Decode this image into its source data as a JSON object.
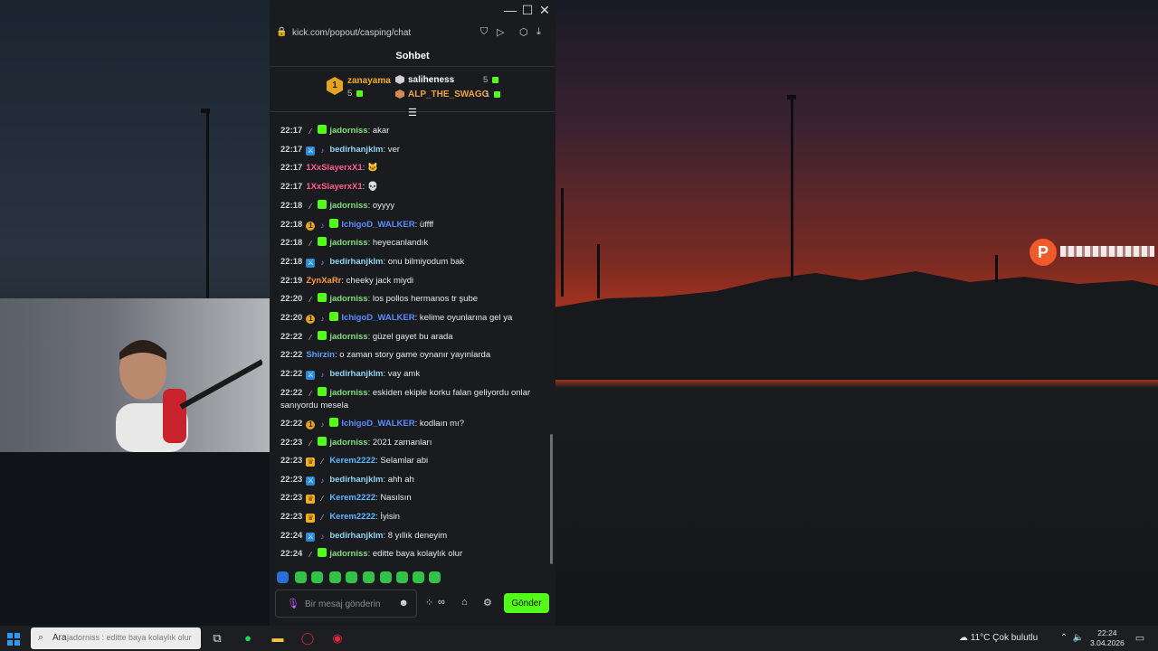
{
  "browser": {
    "url": "kick.com/popout/casping/chat",
    "window_controls": [
      "—",
      "☐",
      "✕"
    ]
  },
  "chat": {
    "title": "Sohbet",
    "leaderboard": {
      "first": {
        "rank": "1",
        "name": "zanayama",
        "count": "5"
      },
      "second": {
        "name": "saliheness",
        "count": "5"
      },
      "third": {
        "name": "ALP_THE_SWAGG",
        "count": "1"
      }
    },
    "messages": [
      {
        "time": "22:17",
        "badges": [
          "sword",
          "green"
        ],
        "user": "jadorniss",
        "color": "#7fe07a",
        "text": "akar"
      },
      {
        "time": "22:17",
        "badges": [
          "blue",
          "note"
        ],
        "user": "bedirhanjklm",
        "color": "#8fd4f0",
        "text": "ver"
      },
      {
        "time": "22:17",
        "badges": [],
        "user": "1XxSlayerxX1",
        "color": "#ff5c8a",
        "text": "🐱"
      },
      {
        "time": "22:17",
        "badges": [],
        "user": "1XxSlayerxX1",
        "color": "#ff5c8a",
        "text": "💀"
      },
      {
        "time": "22:18",
        "badges": [
          "sword",
          "green"
        ],
        "user": "jadorniss",
        "color": "#7fe07a",
        "text": "oyyyy"
      },
      {
        "time": "22:18",
        "badges": [
          "gold",
          "note",
          "green"
        ],
        "user": "IchigoD_WALKER",
        "color": "#5a8cff",
        "text": "üffff"
      },
      {
        "time": "22:18",
        "badges": [
          "sword",
          "green"
        ],
        "user": "jadorniss",
        "color": "#7fe07a",
        "text": "heyecanlandık"
      },
      {
        "time": "22:18",
        "badges": [
          "blue",
          "note"
        ],
        "user": "bedirhanjklm",
        "color": "#8fd4f0",
        "text": "onu bilmiyodum bak"
      },
      {
        "time": "22:19",
        "badges": [],
        "user": "ZynXaRr",
        "color": "#ff9a3c",
        "text": "cheeky jack miydi"
      },
      {
        "time": "22:20",
        "badges": [
          "sword",
          "green"
        ],
        "user": "jadorniss",
        "color": "#7fe07a",
        "text": "los pollos hermanos tr şube"
      },
      {
        "time": "22:20",
        "badges": [
          "gold",
          "note",
          "green"
        ],
        "user": "IchigoD_WALKER",
        "color": "#5a8cff",
        "text": "kelime oyunlarına gel ya"
      },
      {
        "time": "22:22",
        "badges": [
          "sword",
          "green"
        ],
        "user": "jadorniss",
        "color": "#7fe07a",
        "text": "güzel gayet bu arada"
      },
      {
        "time": "22:22",
        "badges": [],
        "user": "Shirzin",
        "color": "#5aa0ff",
        "text": "o zaman story game oynanır yayınlarda"
      },
      {
        "time": "22:22",
        "badges": [
          "blue",
          "note"
        ],
        "user": "bedirhanjklm",
        "color": "#8fd4f0",
        "text": "vay amk"
      },
      {
        "time": "22:22",
        "badges": [
          "sword",
          "green"
        ],
        "user": "jadorniss",
        "color": "#7fe07a",
        "text": "eskiden ekiple korku falan geliyordu onlar sanıyordu mesela"
      },
      {
        "time": "22:22",
        "badges": [
          "gold",
          "note",
          "green"
        ],
        "user": "IchigoD_WALKER",
        "color": "#5a8cff",
        "text": "kodlaın mı?"
      },
      {
        "time": "22:23",
        "badges": [
          "sword",
          "green"
        ],
        "user": "jadorniss",
        "color": "#7fe07a",
        "text": "2021 zamanları"
      },
      {
        "time": "22:23",
        "badges": [
          "crown",
          "sword"
        ],
        "user": "Kerem2222",
        "color": "#5ab8ff",
        "text": "Selamlar abi"
      },
      {
        "time": "22:23",
        "badges": [
          "blue",
          "note"
        ],
        "user": "bedirhanjklm",
        "color": "#8fd4f0",
        "text": "ahh ah"
      },
      {
        "time": "22:23",
        "badges": [
          "crown",
          "sword"
        ],
        "user": "Kerem2222",
        "color": "#5ab8ff",
        "text": "Nasılsın"
      },
      {
        "time": "22:23",
        "badges": [
          "crown",
          "sword"
        ],
        "user": "Kerem2222",
        "color": "#5ab8ff",
        "text": "İyisin"
      },
      {
        "time": "22:24",
        "badges": [
          "blue",
          "note"
        ],
        "user": "bedirhanjklm",
        "color": "#8fd4f0",
        "text": "8 yıllık deneyim"
      },
      {
        "time": "22:24",
        "badges": [
          "sword",
          "green"
        ],
        "user": "jadorniss",
        "color": "#7fe07a",
        "text": "editte baya kolaylık olur"
      }
    ],
    "input": {
      "placeholder": "Bir mesaj gönderin",
      "send_label": "Gönder"
    },
    "accent": "#53fc18"
  },
  "taskbar": {
    "search_label": "Ara",
    "search_overlay": "jadorniss : editte baya kolaylık olur",
    "weather": "11°C  Çok bulutlu",
    "time": "22:24",
    "date": "3.04.2026"
  }
}
